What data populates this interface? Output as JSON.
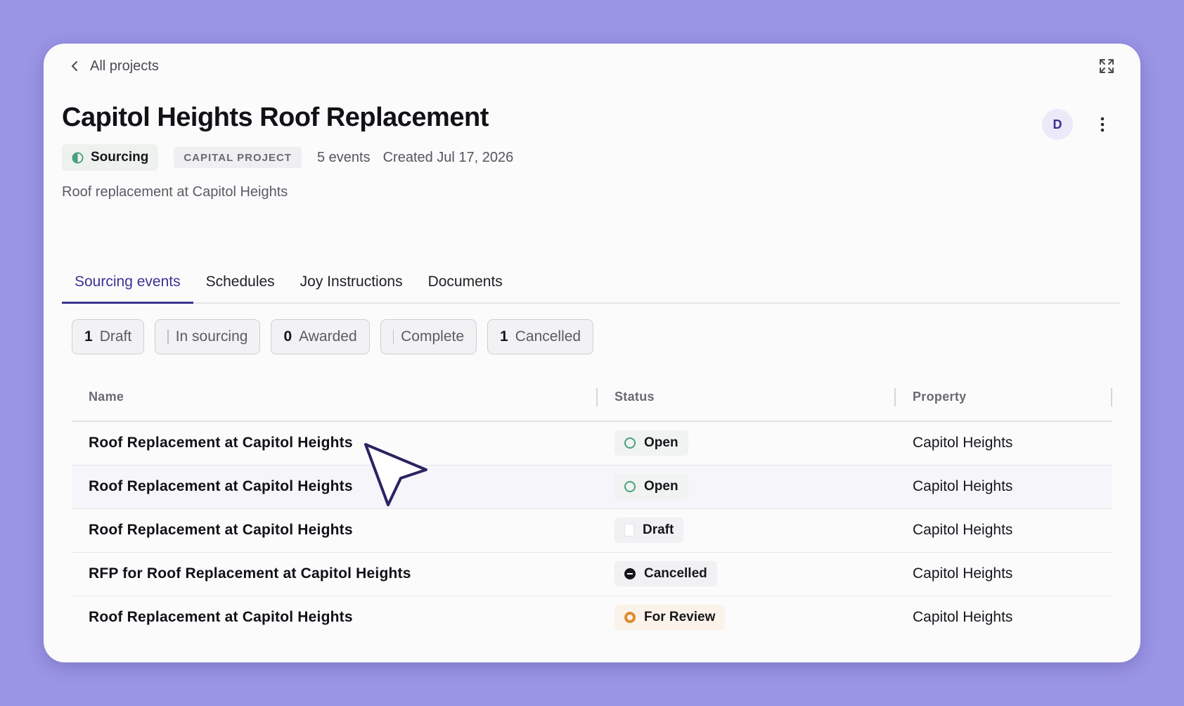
{
  "nav": {
    "back_label": "All projects"
  },
  "project": {
    "title": "Capitol Heights Roof Replacement",
    "status": "Sourcing",
    "type": "CAPITAL PROJECT",
    "events": "5 events",
    "created": "Created Jul 17, 2026",
    "description": "Roof replacement at Capitol Heights",
    "avatar_initial": "D"
  },
  "tabs": [
    {
      "label": "Sourcing events",
      "active": true
    },
    {
      "label": "Schedules"
    },
    {
      "label": "Joy Instructions"
    },
    {
      "label": "Documents"
    }
  ],
  "filters": [
    {
      "count": "1",
      "label": "Draft"
    },
    {
      "count": "",
      "label": "In sourcing"
    },
    {
      "count": "0",
      "label": "Awarded"
    },
    {
      "count": "",
      "label": "Complete"
    },
    {
      "count": "1",
      "label": "Cancelled"
    }
  ],
  "table": {
    "columns": [
      "Name",
      "Status",
      "Property"
    ],
    "rows": [
      {
        "name": "Roof Replacement at Capitol Heights",
        "status": "Open",
        "property": "Capitol Heights"
      },
      {
        "name": "Roof Replacement at Capitol Heights",
        "status": "Open",
        "property": "Capitol Heights"
      },
      {
        "name": "Roof Replacement at Capitol Heights",
        "status": "Draft",
        "property": "Capitol Heights"
      },
      {
        "name": "RFP for Roof Replacement at Capitol Heights",
        "status": "Cancelled",
        "property": "Capitol Heights"
      },
      {
        "name": "Roof Replacement at Capitol Heights",
        "status": "For Review",
        "property": "Capitol Heights"
      }
    ]
  },
  "colors": {
    "background": "#9b95e6",
    "accent": "#3b3391",
    "open": "#49a07a",
    "review": "#e0892f",
    "cancelled": "#15151a"
  },
  "icons": [
    "chevron-left-icon",
    "expand-icon",
    "kebab-icon",
    "half-circle-icon",
    "open-circle-icon",
    "draft-icon",
    "cancelled-icon",
    "review-icon",
    "mouse-cursor-icon"
  ]
}
